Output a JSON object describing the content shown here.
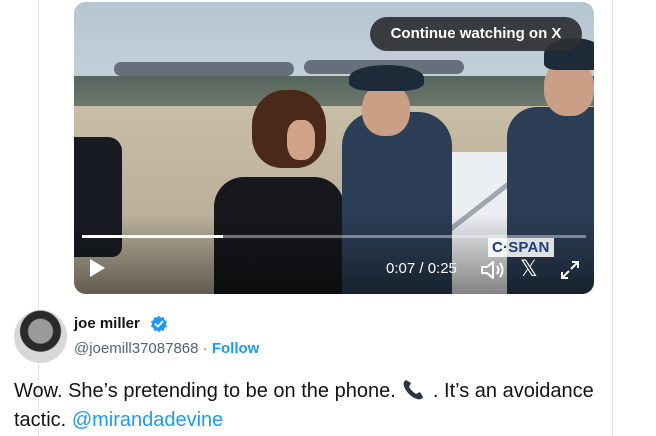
{
  "video": {
    "continue_label": "Continue watching on X",
    "watermark": "C·SPAN",
    "time_display": "0:07 / 0:25",
    "progress_fraction": 0.28
  },
  "author": {
    "name": "joe miller",
    "handle": "@joemill37087868",
    "separator": "·",
    "follow_label": "Follow"
  },
  "tweet": {
    "text_part1": "Wow. She’s pretending to be on the phone.",
    "text_part2": ". It’s an avoidance tactic.",
    "mention": "@mirandadevine"
  },
  "colors": {
    "accent": "#1d9bf0",
    "text": "#0f1419",
    "secondary": "#536471"
  },
  "icons": [
    "play-icon",
    "volume-icon",
    "x-logo-icon",
    "expand-icon",
    "verified-badge-icon",
    "phone-emoji-icon"
  ]
}
